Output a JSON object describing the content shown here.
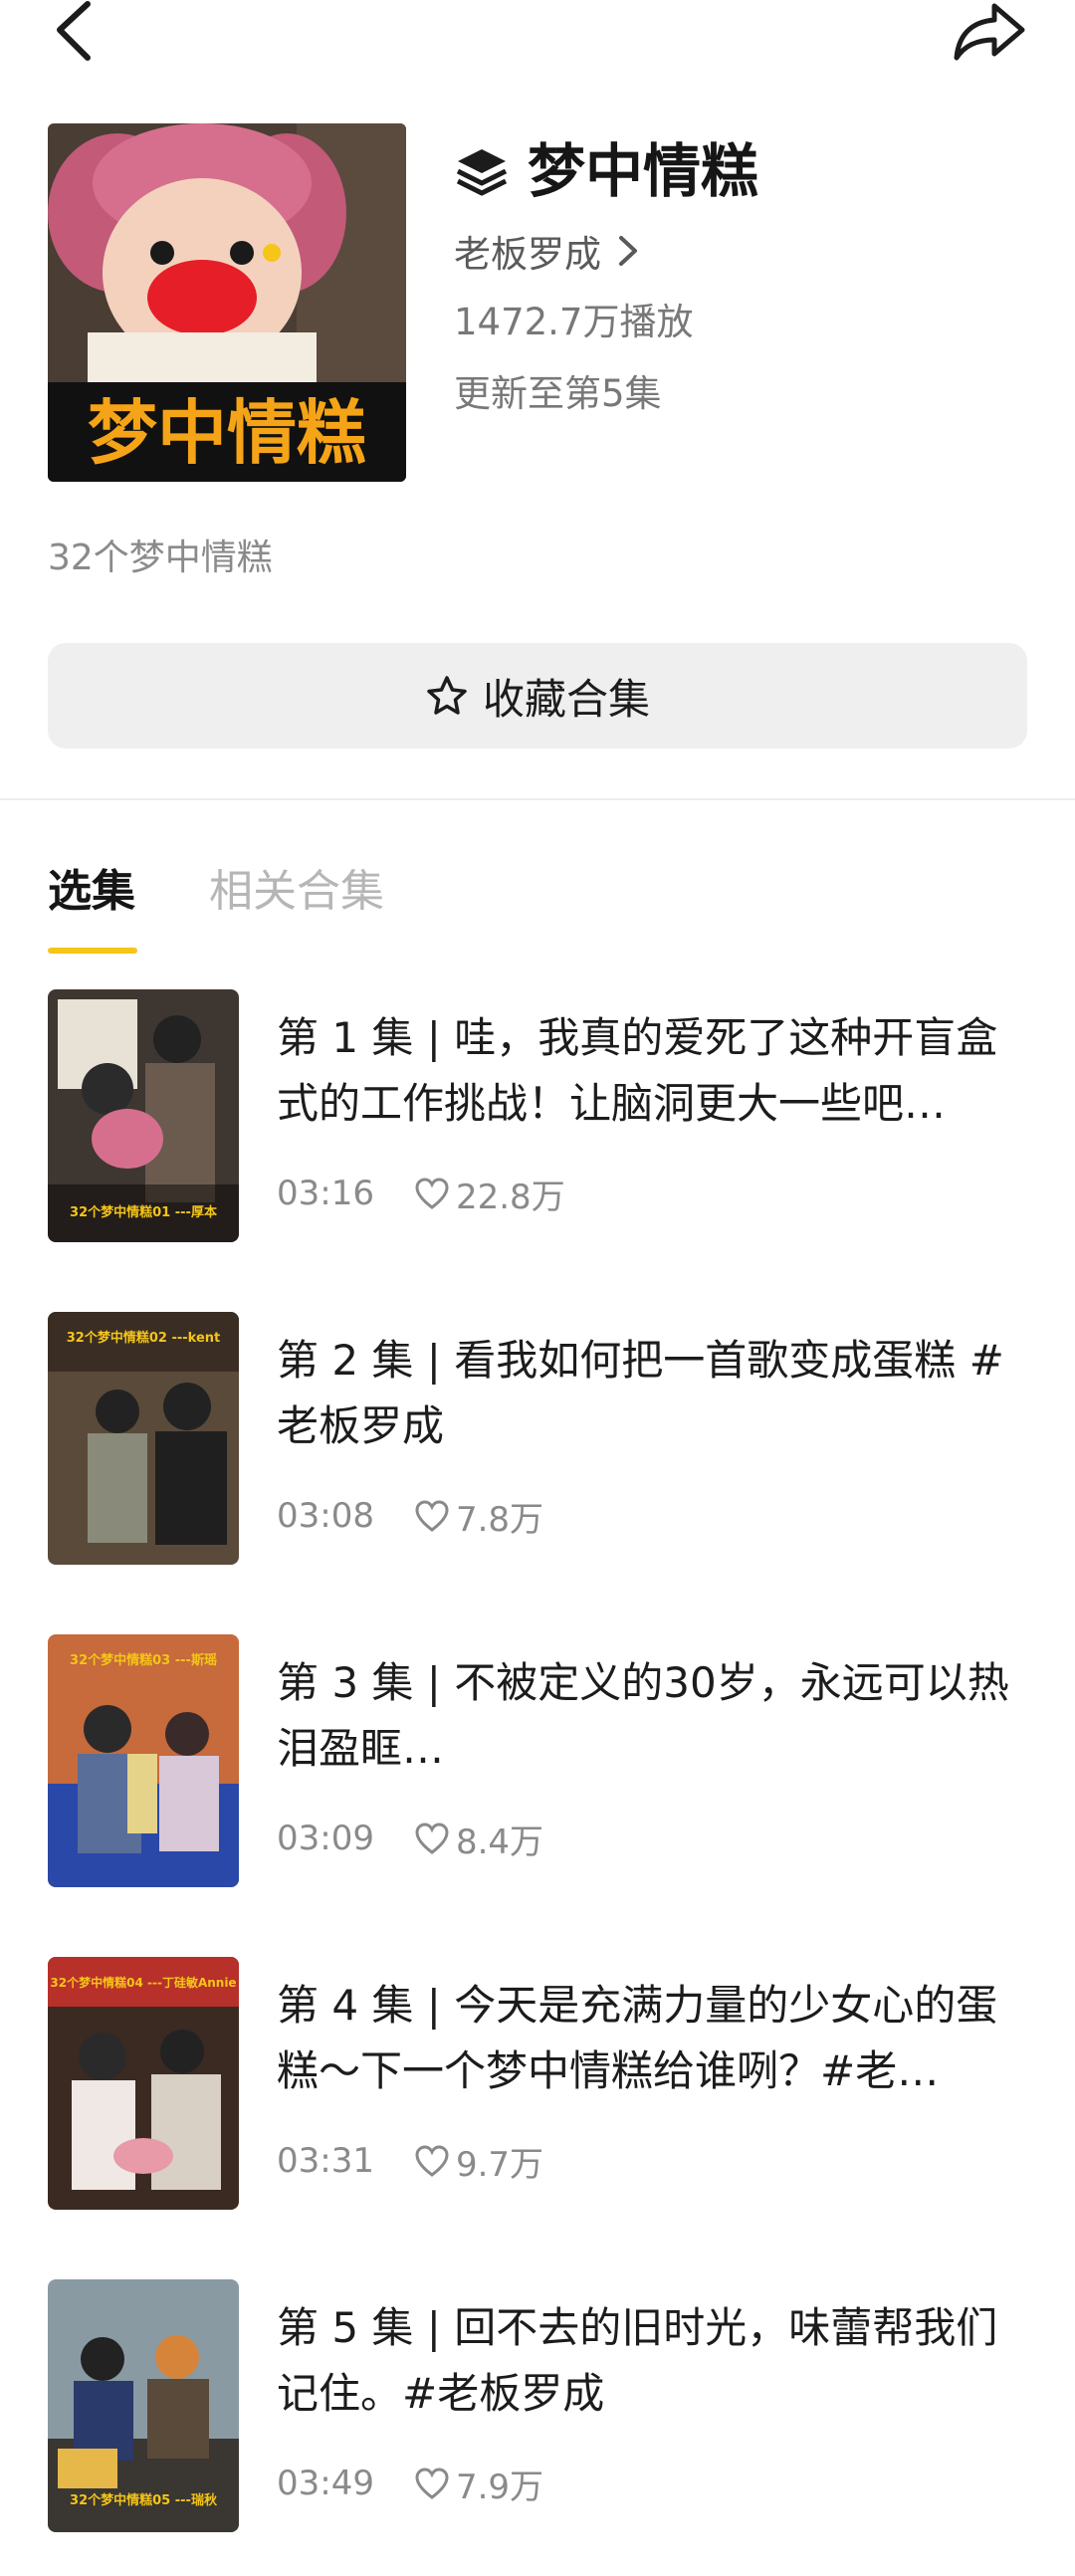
{
  "header": {
    "title": "梦中情糕",
    "author": "老板罗成",
    "plays": "1472.7万播放",
    "updated": "更新至第5集",
    "cover_text": "梦中情糕"
  },
  "description": "32个梦中情糕",
  "actions": {
    "favorite_label": "收藏合集"
  },
  "tabs": [
    {
      "label": "选集",
      "active": true
    },
    {
      "label": "相关合集",
      "active": false
    }
  ],
  "episodes": [
    {
      "title": "第 1 集 | 哇，我真的爱死了这种开盲盒式的工作挑战！让脑洞更大一些吧…",
      "duration": "03:16",
      "likes": "22.8万",
      "thumb_caption": "32个梦中情糕01 ---厚本"
    },
    {
      "title": "第 2 集 | 看我如何把一首歌变成蛋糕 #老板罗成",
      "duration": "03:08",
      "likes": "7.8万",
      "thumb_caption": "32个梦中情糕02 ---kent"
    },
    {
      "title": "第 3 集 | 不被定义的30岁，永远可以热泪盈眶…",
      "duration": "03:09",
      "likes": "8.4万",
      "thumb_caption": "32个梦中情糕03 ---斯瑶"
    },
    {
      "title": "第 4 集 | 今天是充满力量的少女心的蛋糕～下一个梦中情糕给谁咧？#老…",
      "duration": "03:31",
      "likes": "9.7万",
      "thumb_caption": "32个梦中情糕04 ---丁硅敏Annie"
    },
    {
      "title": "第 5 集 | 回不去的旧时光，味蕾帮我们记住。#老板罗成",
      "duration": "03:49",
      "likes": "7.9万",
      "thumb_caption": "32个梦中情糕05 ---瑞秋"
    }
  ],
  "colors": {
    "accent": "#f5c518",
    "button_bg": "#efefef",
    "muted": "#8a8a8a"
  }
}
